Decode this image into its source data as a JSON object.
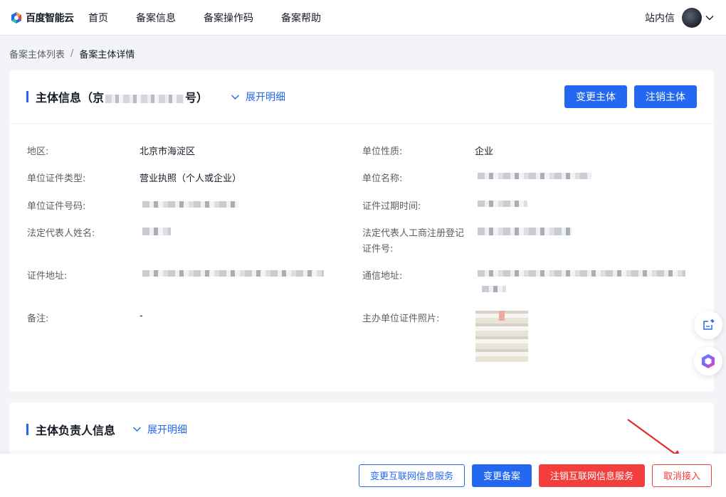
{
  "brand": {
    "name": "百度智能云",
    "logo_colors": [
      "#2468f2",
      "#20c997",
      "#f5a623",
      "#e8423f"
    ]
  },
  "nav": {
    "items": [
      "首页",
      "备案信息",
      "备案操作码",
      "备案帮助"
    ]
  },
  "topbar": {
    "message_link": "站内信"
  },
  "breadcrumb": {
    "parent": "备案主体列表",
    "separator": "/",
    "current": "备案主体详情"
  },
  "subject": {
    "title_prefix": "主体信息（京",
    "title_suffix": "号）",
    "expand_label": "展开明细",
    "buttons": {
      "change": "变更主体",
      "cancel": "注销主体"
    },
    "fields": {
      "region_label": "地区:",
      "region_value": "北京市海淀区",
      "nature_label": "单位性质:",
      "nature_value": "企业",
      "cert_type_label": "单位证件类型:",
      "cert_type_value": "营业执照（个人或企业）",
      "name_label": "单位名称:",
      "cert_no_label": "单位证件号码:",
      "expiry_label": "证件过期时间:",
      "legal_rep_label": "法定代表人姓名:",
      "legal_reg_label_1": "法定代表人工商注册登记",
      "legal_reg_label_2": "证件号:",
      "cert_addr_label": "证件地址:",
      "mail_addr_label": "通信地址:",
      "remark_label": "备注:",
      "remark_value": "-",
      "photo_label": "主办单位证件照片:"
    }
  },
  "owner": {
    "title": "主体负责人信息",
    "expand_label": "展开明细"
  },
  "bottom_actions": {
    "change_internet": "变更互联网信息服务",
    "change_record": "变更备案",
    "cancel_internet": "注销互联网信息服务",
    "cancel_access": "取消接入"
  },
  "colors": {
    "primary": "#2468f2",
    "danger": "#f33e3e",
    "annotation_arrow": "#e32b2b"
  }
}
